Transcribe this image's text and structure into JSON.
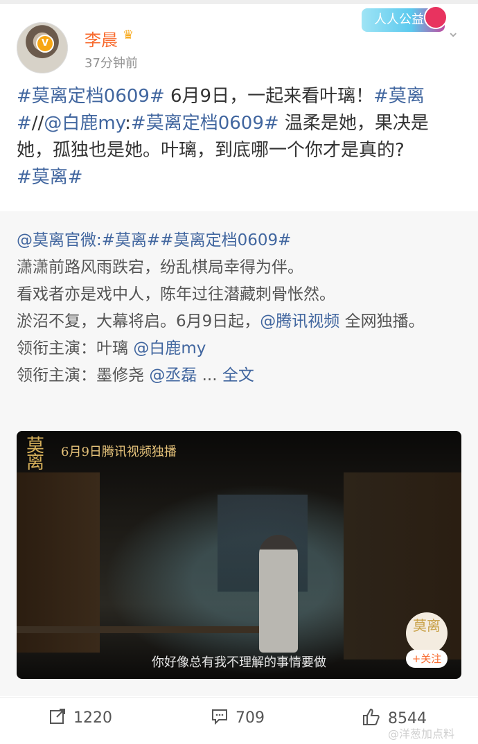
{
  "header": {
    "username": "李晨",
    "timestamp": "37分钟前",
    "charity_badge": "人人公益",
    "verified_badge_icon": "verified-v-icon",
    "vip_icon": "crown-icon",
    "menu_icon": "chevron-down-icon"
  },
  "post": {
    "tag1": "#莫离定档0609#",
    "text1": " 6月9日，一起来看叶璃！",
    "tag2": "#莫离#",
    "sep": "//",
    "mention1": "@白鹿my",
    "colon": ":",
    "tag3": "#莫离定档0609#",
    "text2": " 温柔是她，果决是她，孤独也是她。叶璃，到底哪一个你才是真的?",
    "tag4": "#莫离#"
  },
  "repost": {
    "author": "@莫离官微",
    "colon": ":",
    "tags": "#莫离##莫离定档0609#",
    "line1": "潇潇前路风雨跌宕，纷乱棋局幸得为伴。",
    "line2": "看戏者亦是戏中人，陈年过往潜藏刺骨怅然。",
    "line3a": "淤沼不复，大幕将启。6月9日起，",
    "line3_mention": "@腾讯视频",
    "line3b": " 全网独播。",
    "line4a": "领衔主演：叶璃 ",
    "line4_mention": "@白鹿my",
    "line5a": "领衔主演：墨修尧 ",
    "line5_mention": "@丞磊",
    "line5b": " ... ",
    "full_text_link": "全文"
  },
  "video": {
    "seal_text": "莫离",
    "top_caption": "6月9日腾讯视频独播",
    "subtitle": "你好像总有我不理解的事情要做",
    "follow_logo": "莫离",
    "follow_button": "+关注"
  },
  "actions": {
    "repost_count": "1220",
    "comment_count": "709",
    "like_count": "8544"
  },
  "watermark": "@洋葱加点料",
  "colors": {
    "link": "#41669f",
    "username": "#f86b2f",
    "repost_bg": "#f7f7f7"
  }
}
